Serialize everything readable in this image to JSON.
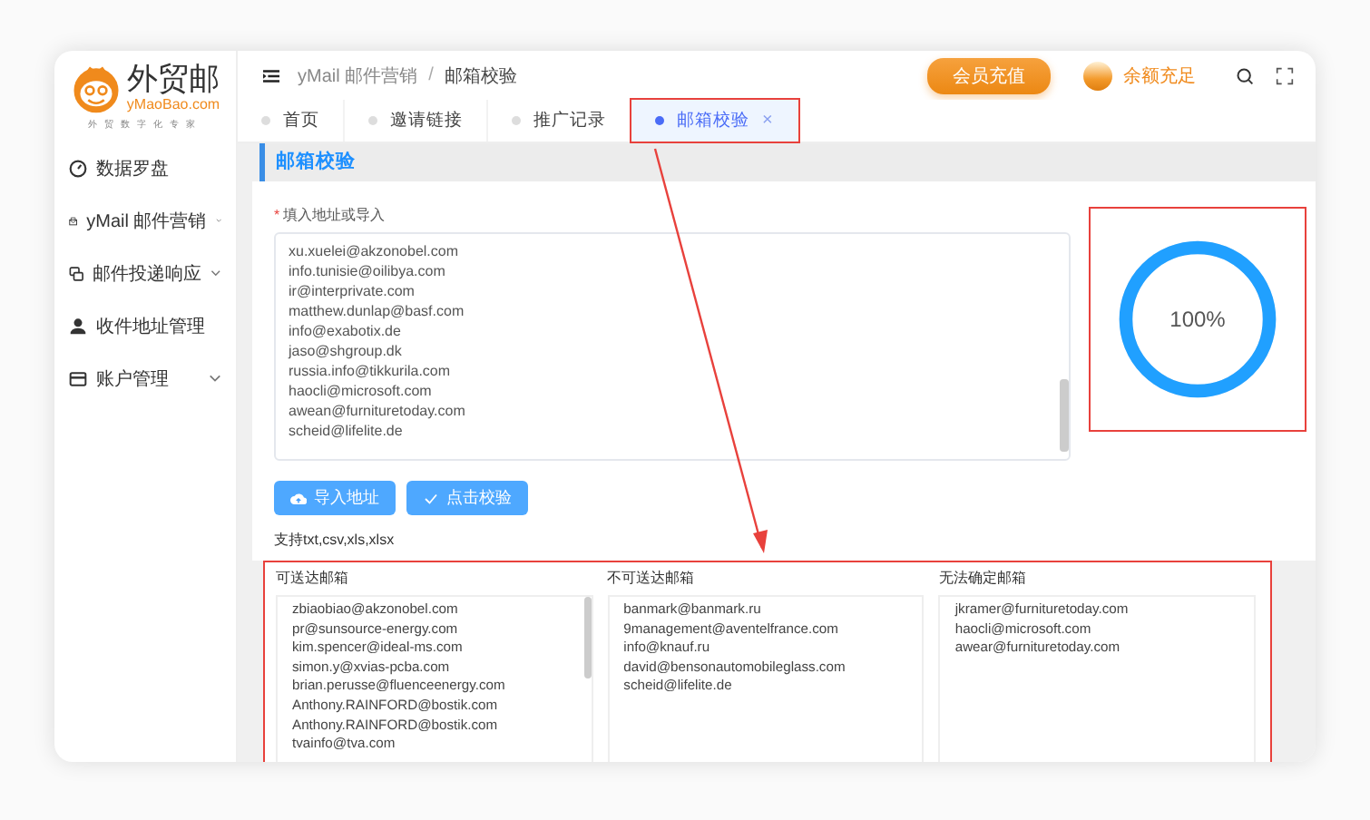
{
  "logo": {
    "name": "外贸邮",
    "domain": "yMaoBao.com",
    "slogan": "外贸数字化专家"
  },
  "sidebar": {
    "items": [
      {
        "label": "数据罗盘",
        "expandable": false
      },
      {
        "label": "yMail 邮件营销",
        "expandable": true
      },
      {
        "label": "邮件投递响应",
        "expandable": true
      },
      {
        "label": "收件地址管理",
        "expandable": false
      },
      {
        "label": "账户管理",
        "expandable": true
      }
    ]
  },
  "breadcrumb": {
    "items": [
      "yMail 邮件营销",
      "邮箱校验"
    ],
    "separator": "/"
  },
  "header": {
    "recharge_button": "会员充值",
    "balance": "余额充足"
  },
  "tabs": [
    {
      "label": "首页",
      "selected": false,
      "highlighted": false
    },
    {
      "label": "邀请链接",
      "selected": false,
      "highlighted": false
    },
    {
      "label": "推广记录",
      "selected": false,
      "highlighted": false
    },
    {
      "label": "邮箱校验",
      "selected": true,
      "highlighted": true,
      "close": "×"
    }
  ],
  "section_title": "邮箱校验",
  "form": {
    "label": "填入地址或导入",
    "required_mark": "*",
    "emails": [
      "xu.xuelei@akzonobel.com",
      "info.tunisie@oilibya.com",
      "ir@interprivate.com",
      "matthew.dunlap@basf.com",
      "info@exabotix.de",
      "jaso@shgroup.dk",
      "russia.info@tikkurila.com",
      "haocli@microsoft.com",
      "awean@furnituretoday.com",
      "scheid@lifelite.de"
    ],
    "buttons": [
      {
        "label": "导入地址"
      },
      {
        "label": "点击校验"
      }
    ],
    "hint": "支持txt,csv,xls,xlsx"
  },
  "progress": {
    "level": 1,
    "reading": "100%",
    "highlighted": true
  },
  "results": {
    "highlighted": true,
    "columns": [
      {
        "title": "可送达邮箱",
        "emails": [
          "zbiaobiao@akzonobel.com",
          "pr@sunsource-energy.com",
          "kim.spencer@ideal-ms.com",
          "simon.y@xvias-pcba.com",
          "brian.perusse@fluenceenergy.com",
          "Anthony.RAINFORD@bostik.com",
          "Anthony.RAINFORD@bostik.com",
          "tvainfo@tva.com"
        ]
      },
      {
        "title": "不可送达邮箱",
        "emails": [
          "banmark@banmark.ru",
          "9management@aventelfrance.com",
          "info@knauf.ru",
          "david@bensonautomobileglass.com",
          "scheid@lifelite.de"
        ]
      },
      {
        "title": "无法确定邮箱",
        "emails": [
          "jkramer@furnituretoday.com",
          "haocli@microsoft.com",
          "awear@furnituretoday.com"
        ]
      }
    ]
  }
}
